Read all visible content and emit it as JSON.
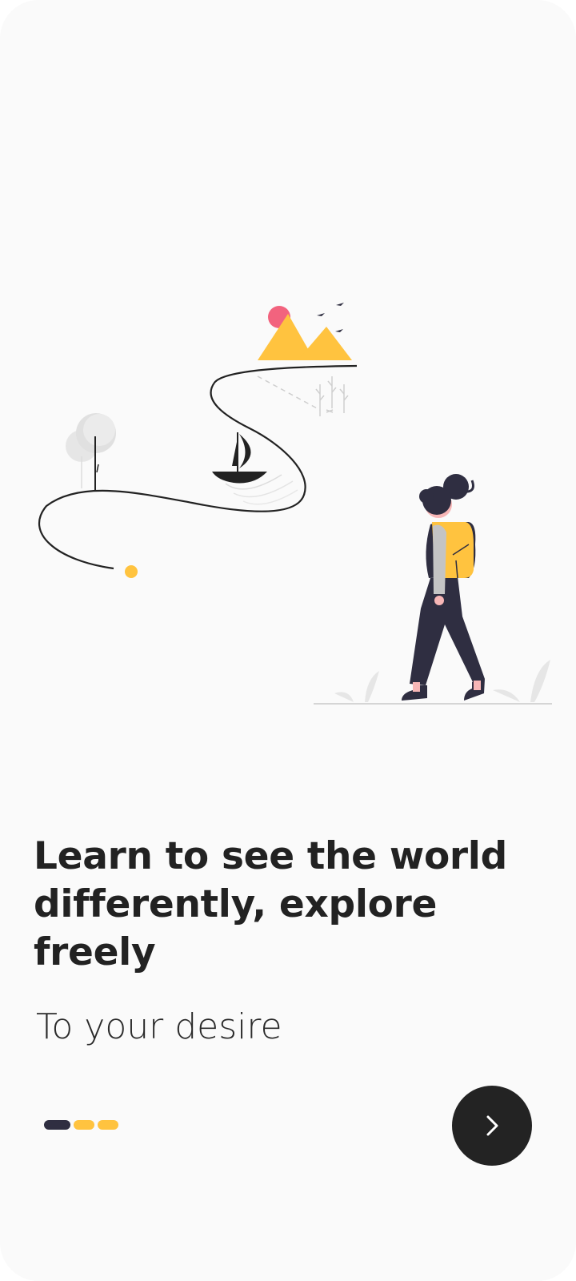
{
  "onboarding": {
    "headline": "Learn to see the world differently, explore freely",
    "subtitle": "To your desire",
    "pager": {
      "total": 3,
      "active_index": 0,
      "active_color": "#2f2e41",
      "inactive_color": "#ffc33f"
    },
    "next_button": {
      "icon": "chevron-right-icon"
    }
  },
  "colors": {
    "background": "#fafafa",
    "text": "#222222",
    "accent_yellow": "#ffc33f",
    "accent_dark": "#2f2e41",
    "sun_pink": "#f2637e",
    "button": "#232323"
  }
}
